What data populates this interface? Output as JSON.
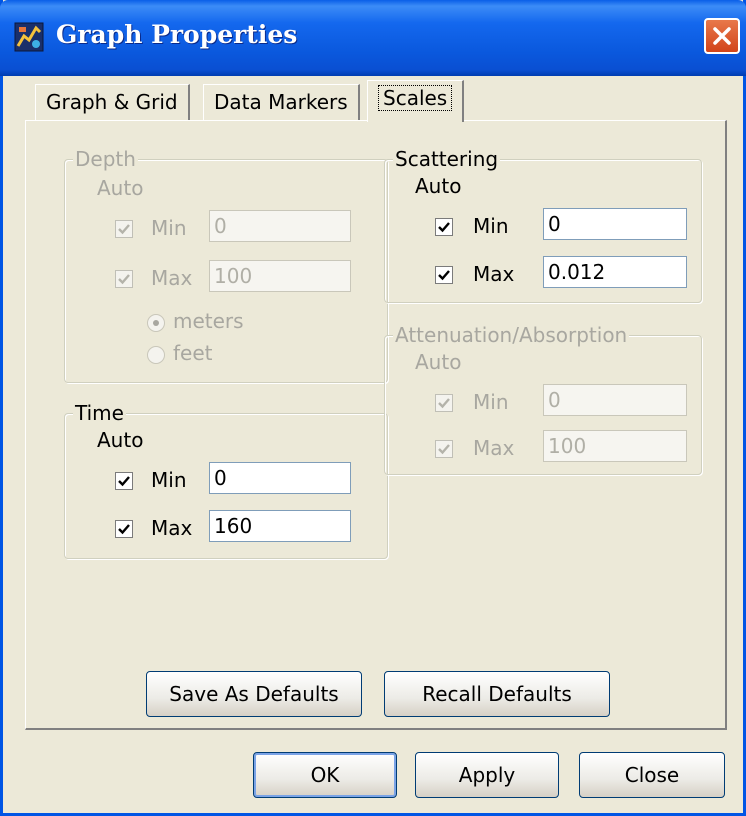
{
  "window": {
    "title": "Graph Properties"
  },
  "tabs": [
    {
      "label": "Graph & Grid"
    },
    {
      "label": "Data Markers"
    },
    {
      "label": "Scales"
    }
  ],
  "depth": {
    "label": "Depth",
    "auto_label": "Auto",
    "min_label": "Min",
    "max_label": "Max",
    "min_value": "0",
    "max_value": "100",
    "min_checked": true,
    "max_checked": true,
    "units": [
      "meters",
      "feet"
    ],
    "selected_unit": "meters"
  },
  "time": {
    "label": "Time",
    "auto_label": "Auto",
    "min_label": "Min",
    "max_label": "Max",
    "min_value": "0",
    "max_value": "160",
    "min_checked": true,
    "max_checked": true
  },
  "scattering": {
    "label": "Scattering",
    "auto_label": "Auto",
    "min_label": "Min",
    "max_label": "Max",
    "min_value": "0",
    "max_value": "0.012",
    "min_checked": true,
    "max_checked": true
  },
  "attenuation": {
    "label": "Attenuation/Absorption",
    "auto_label": "Auto",
    "min_label": "Min",
    "max_label": "Max",
    "min_value": "0",
    "max_value": "100",
    "min_checked": true,
    "max_checked": true
  },
  "buttons": {
    "save_defaults": "Save As Defaults",
    "recall_defaults": "Recall Defaults",
    "ok": "OK",
    "apply": "Apply",
    "close": "Close"
  },
  "icons": {
    "app": "graph-app-icon",
    "close": "close-icon",
    "check": "checkmark-icon"
  },
  "colors": {
    "titlebar": "#0a58dd",
    "close_button": "#d2441a",
    "dialog_bg": "#ece9d8",
    "disabled_text": "#a8a7a0"
  }
}
